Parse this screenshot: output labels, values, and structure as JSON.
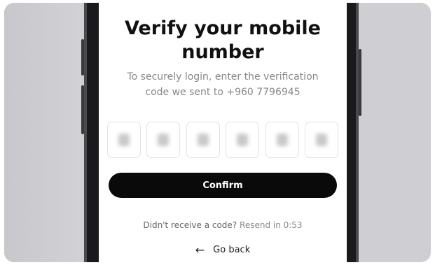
{
  "screen": {
    "title_line1": "Verify your mobile",
    "title_line2": "number",
    "subtitle_line1": "To securely login, enter the verification",
    "subtitle_line2": "code we sent to +960 7796945",
    "code_digits": [
      "",
      "",
      "",
      "",
      "",
      ""
    ],
    "confirm_label": "Confirm",
    "resend_prompt": "Didn't receive a code?",
    "resend_label": "Resend in 0:53",
    "back_label": "Go back",
    "back_icon": "arrow-left-icon"
  },
  "colors": {
    "button_bg": "#0a0a0a",
    "background_frame": "#cfcfd3"
  }
}
